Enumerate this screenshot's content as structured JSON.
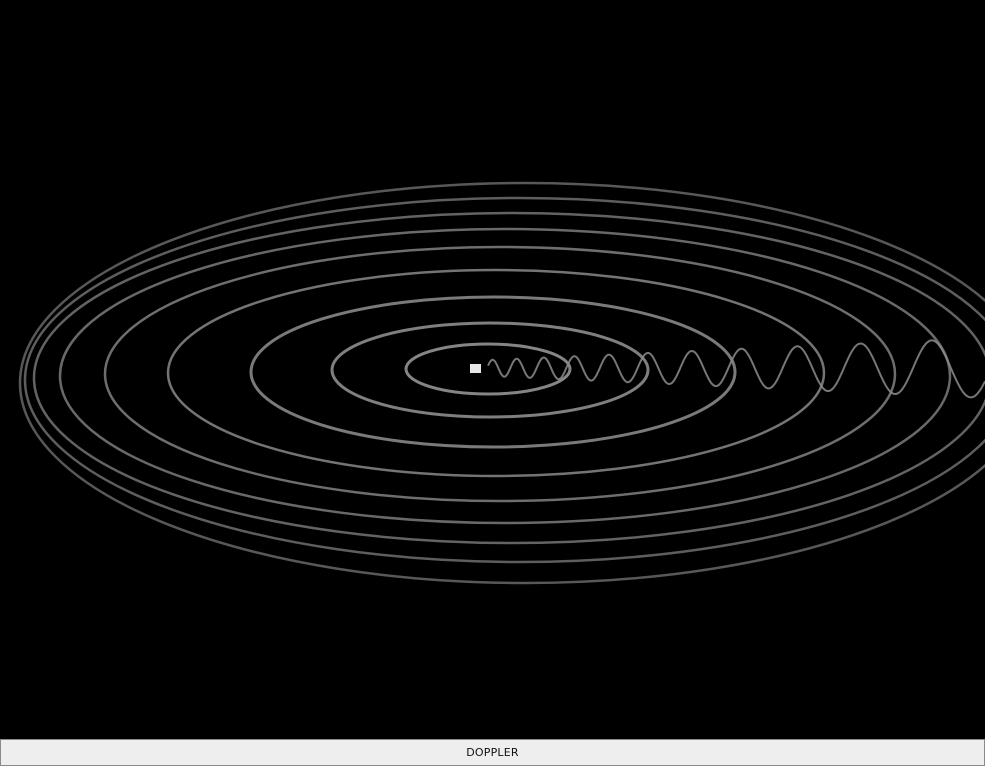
{
  "animation": {
    "ring_count": 9,
    "background_color": "#000000",
    "wave_color": "#8c8c8c",
    "source_color": "#e6e6e6",
    "source_name": "sound-source"
  },
  "caption": {
    "label": "DOPPLER"
  }
}
